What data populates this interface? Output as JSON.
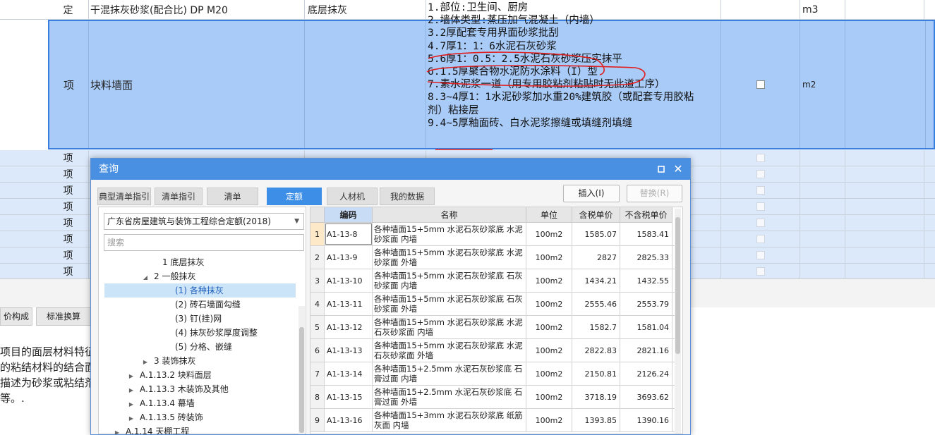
{
  "sheet": {
    "row1": {
      "type": "定",
      "name": "干混抹灰砂浆(配合比) DP M20",
      "feature": "底层抹灰",
      "unit": "m3"
    },
    "row2": {
      "type": "项",
      "name": "块料墙面",
      "desc": [
        "1.部位:卫生间、厨房",
        "2.墙体类型:蒸压加气混凝土（内墙）",
        "3.2厚配套专用界面砂浆批刮",
        "4.7厚1：1：6水泥石灰砂浆",
        "5.6厚1：0.5：2.5水泥石灰砂浆压实抹平",
        "6.1.5厚聚合物水泥防水涂料（I）型",
        "7.素水泥浆一道（用专用胶粘剂粘贴时无此道工序）",
        "8.3~4厚1：1水泥砂浆加水重20%建筑胶（或配套专用胶粘",
        "剂）粘接层",
        "9.4~5厚釉面砖、白水泥浆擦缝或填缝剂填缝"
      ],
      "unit": "m2"
    },
    "lower_rows": [
      "项",
      "项",
      "项",
      "项",
      "项",
      "项",
      "项",
      "项"
    ]
  },
  "bottom": {
    "tabs": [
      "价构成",
      "标准换算"
    ],
    "text_lines": [
      "项目的面层材料特征",
      "的粘结材料的结合面",
      "描述为砂浆或粘结剂",
      "等。."
    ]
  },
  "dialog": {
    "title": "查询",
    "tabs": [
      "典型清单指引",
      "清单指引",
      "清单",
      "定额",
      "人材机",
      "我的数据"
    ],
    "active_tab": "定额",
    "insert_button": "插入(I)",
    "replace_button": "替换(R)",
    "library": "广东省房屋建筑与装饰工程综合定额(2018)",
    "search_placeholder": "搜索",
    "tree": [
      {
        "label": "1 底层抹灰",
        "toggle": ""
      },
      {
        "label": "2 一般抹灰",
        "toggle": "◢"
      },
      {
        "label": "(1) 各种抹灰",
        "toggle": ""
      },
      {
        "label": "(2) 砖石墙面勾缝",
        "toggle": ""
      },
      {
        "label": "(3) 钉(挂)网",
        "toggle": ""
      },
      {
        "label": "(4) 抹灰砂浆厚度调整",
        "toggle": ""
      },
      {
        "label": "(5) 分格、嵌缝",
        "toggle": ""
      },
      {
        "label": "3 装饰抹灰",
        "toggle": "▶"
      },
      {
        "label": "A.1.13.2 块料面层",
        "toggle": "▶"
      },
      {
        "label": "A.1.13.3 木装饰及其他",
        "toggle": "▶"
      },
      {
        "label": "A.1.13.4 幕墙",
        "toggle": "▶"
      },
      {
        "label": "A.1.13.5 砖装饰",
        "toggle": "▶"
      },
      {
        "label": "A.1.14 天棚工程",
        "toggle": "▶"
      }
    ],
    "table": {
      "headers": [
        "",
        "编码",
        "名称",
        "单位",
        "含税单价",
        "不含税单价"
      ],
      "rows": [
        {
          "n": "1",
          "code": "A1-13-8",
          "name": "各种墙面15+5mm 水泥石灰砂浆底 水泥砂浆面 内墙",
          "unit": "100m2",
          "tax": "1585.07",
          "notax": "1583.41"
        },
        {
          "n": "2",
          "code": "A1-13-9",
          "name": "各种墙面15+5mm 水泥石灰砂浆底 水泥砂浆面 外墙",
          "unit": "100m2",
          "tax": "2827",
          "notax": "2825.33"
        },
        {
          "n": "3",
          "code": "A1-13-10",
          "name": "各种墙面15+5mm 水泥石灰砂浆底 石灰砂浆面 内墙",
          "unit": "100m2",
          "tax": "1434.21",
          "notax": "1432.55"
        },
        {
          "n": "4",
          "code": "A1-13-11",
          "name": "各种墙面15+5mm 水泥石灰砂浆底 石灰砂浆面 外墙",
          "unit": "100m2",
          "tax": "2555.46",
          "notax": "2553.79"
        },
        {
          "n": "5",
          "code": "A1-13-12",
          "name": "各种墙面15+5mm 水泥石灰砂浆底 水泥石灰砂浆面 内墙",
          "unit": "100m2",
          "tax": "1582.7",
          "notax": "1581.04"
        },
        {
          "n": "6",
          "code": "A1-13-13",
          "name": "各种墙面15+5mm 水泥石灰砂浆底 水泥石灰砂浆面 外墙",
          "unit": "100m2",
          "tax": "2822.83",
          "notax": "2821.16"
        },
        {
          "n": "7",
          "code": "A1-13-14",
          "name": "各种墙面15+2.5mm 水泥石灰砂浆底 石膏过面 内墙",
          "unit": "100m2",
          "tax": "2150.81",
          "notax": "2126.24"
        },
        {
          "n": "8",
          "code": "A1-13-15",
          "name": "各种墙面15+2.5mm 水泥石灰砂浆底 石膏过面 外墙",
          "unit": "100m2",
          "tax": "3718.19",
          "notax": "3693.62"
        },
        {
          "n": "9",
          "code": "A1-13-16",
          "name": "各种墙面15+3mm 水泥石灰砂浆底 纸筋灰面 内墙",
          "unit": "100m2",
          "tax": "1393.85",
          "notax": "1390.16"
        }
      ]
    }
  },
  "colors": {
    "accent": "#4a90e2",
    "selection": "#a9cbf8",
    "annotation": "#e02020"
  }
}
